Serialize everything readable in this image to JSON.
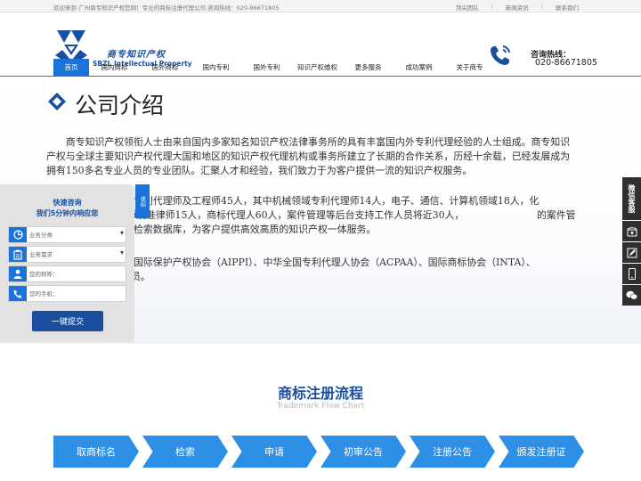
{
  "topbar": {
    "welcome": "欢迎来到 广州商专知识产权官网！专业的商标注册代理公司 咨询热线：020-86671805",
    "links": [
      "顶尖团队",
      "新闻资讯",
      "联系我们"
    ]
  },
  "header": {
    "logo_cn": "商专知识产权",
    "logo_en": "SBZL Intellectual Property",
    "hotline_label": "咨询热线：",
    "hotline_number": "020-86671805"
  },
  "nav": {
    "items": [
      "首页",
      "国内商标",
      "国外商标",
      "国内专利",
      "国外专利",
      "知识产权维权",
      "更多服务",
      "成功案例",
      "关于商专"
    ],
    "active_index": 0
  },
  "intro": {
    "title": "公司介绍",
    "p1": "　　商专知识产权领衔人士由来自国内多家知名知识产权法律事务所的具有丰富国内外专利代理经验的人士组成。商专知识产权与全球主要知识产权代理大国和地区的知识产权代理机构或事务所建立了长期的合作关系，历经十余载，已经发展成为拥有150多名专业人员的专业团队。汇聚人才和经验，我们致力于为客户提供一流的知识产权服务。",
    "p2": "　　　　　　　　　专利代理师及工程师45人，其中机械领域专利代理师14人，电子、通信、计算机领域18人，化　　　　　　　　利代理师13人，律师及准律师15人，商标代理人60人，案件管理等后台支持工作人员将近30人，　　　　　　　　的案件管理系统和强大的专利检索数据库，为客户提供高效高质的知识产权一体服务。",
    "p3": "　　　　　　　　为国际保护产权协会（AIPPI）、中华全国专利代理人协会（ACPAA）、国际商标协会（INTA）、　　　　　　　A）等专业协会的会员。"
  },
  "consult": {
    "title_line1": "快速咨询",
    "title_line2": "我们5分钟内响应您",
    "business_type": "业务分类",
    "business_need": "业务需求",
    "name_placeholder": "您的称呼：",
    "phone_placeholder": "您的手机：",
    "submit": "一键提交",
    "close": "收起"
  },
  "side_tools": {
    "wechat_service": "微信客服"
  },
  "process": {
    "title": "商标注册流程",
    "subtitle": "Trademark Flow Chart",
    "steps": [
      "取商标名",
      "检索",
      "申请",
      "初审公告",
      "注册公告",
      "颁发注册证"
    ]
  },
  "colors": {
    "brand_blue": "#1a4fa0",
    "nav_active": "#1a73d9",
    "step_blue": "#2e8fe6"
  }
}
